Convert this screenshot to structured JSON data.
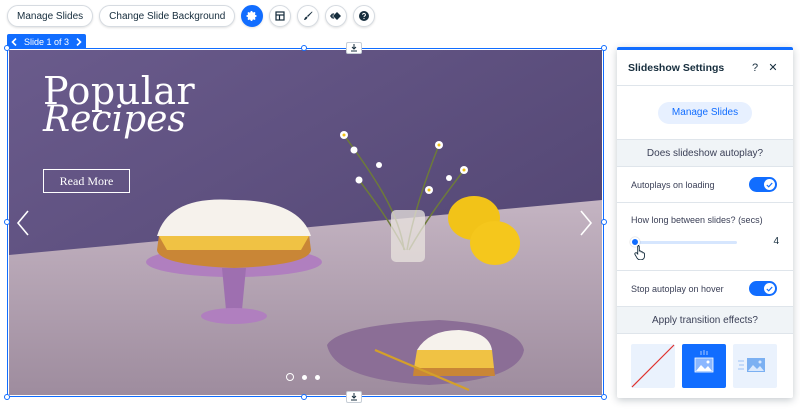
{
  "toolbar": {
    "manage_slides": "Manage Slides",
    "change_background": "Change Slide Background",
    "icons": [
      "gear-icon",
      "layout-icon",
      "design-brush-icon",
      "animation-icon",
      "help-icon"
    ]
  },
  "slide_nav": {
    "label": "Slide 1 of 3"
  },
  "slide": {
    "title_line1": "Popular",
    "title_line2": "Recipes",
    "button": "Read More",
    "dots_count": 3,
    "active_dot": 1
  },
  "panel": {
    "title": "Slideshow Settings",
    "help": "?",
    "close": "✕",
    "manage_button": "Manage Slides",
    "autoplay_section": "Does slideshow autoplay?",
    "autoplay_label": "Autoplays on loading",
    "autoplay_on": true,
    "interval_label": "How long between slides? (secs)",
    "interval_value": "4",
    "stop_hover_label": "Stop autoplay on hover",
    "stop_hover_on": true,
    "transition_section": "Apply transition effects?",
    "transitions": [
      "none",
      "crossfade",
      "slide"
    ],
    "selected_transition": 1
  },
  "colors": {
    "accent": "#116dff",
    "wall": "#5c4e7e",
    "table": "#b8a7b6",
    "lemon": "#f2c318"
  }
}
